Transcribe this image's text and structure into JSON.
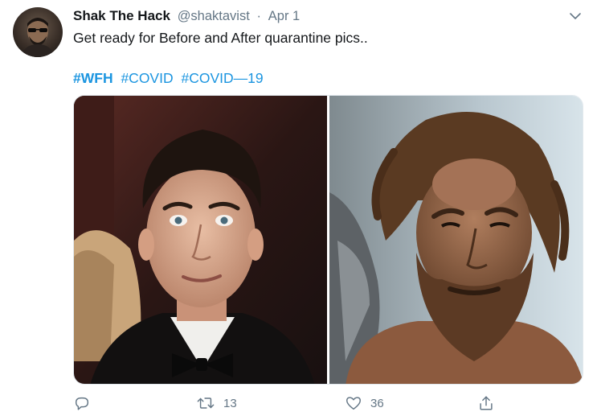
{
  "author": {
    "display_name": "Shak The Hack",
    "handle": "@shaktavist",
    "separator": "·",
    "date": "Apr 1"
  },
  "tweet": {
    "text": "Get ready for Before and After quarantine pics..",
    "hashtags": [
      "#WFH",
      "#COVID",
      "#COVID—19"
    ]
  },
  "actions": {
    "reply_count": "",
    "retweet_count": "13",
    "like_count": "36"
  },
  "colors": {
    "link": "#1b95e0",
    "secondary_text": "#657786",
    "primary_text": "#14171a",
    "border": "#e1e8ed"
  },
  "icons": {
    "caret": "chevron-down-icon",
    "reply": "reply-icon",
    "retweet": "retweet-icon",
    "like": "heart-icon",
    "share": "share-icon"
  }
}
